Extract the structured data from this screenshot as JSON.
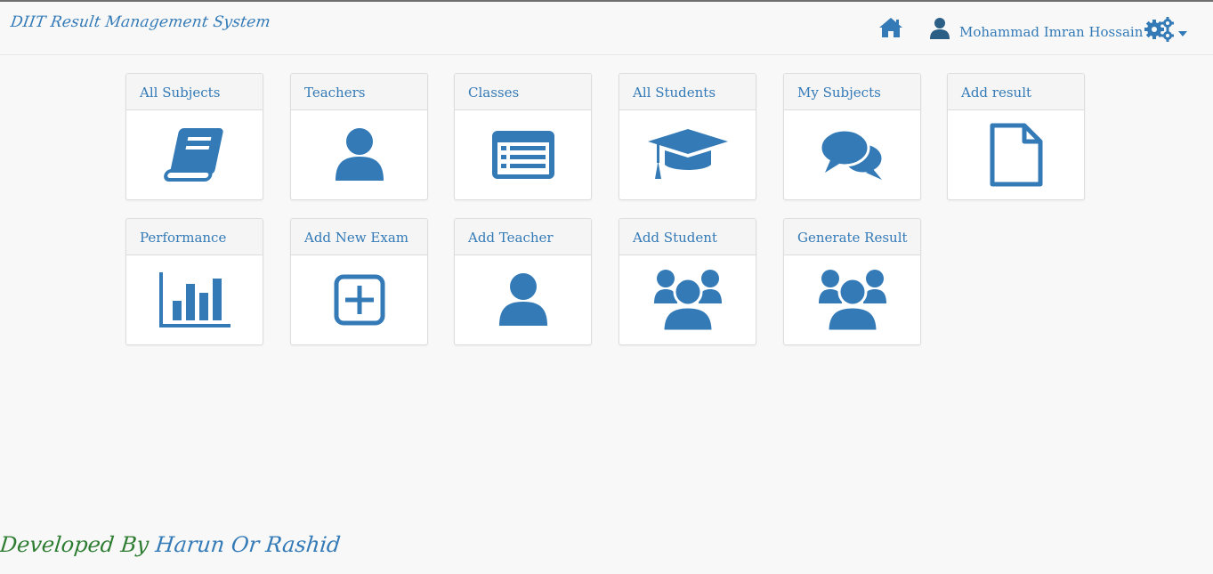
{
  "app": {
    "brand": "DIIT Result Management System"
  },
  "navbar": {
    "home_icon": "home-icon",
    "user_icon": "user-icon",
    "user_name": "Mohammad Imran Hossain",
    "settings_icon": "cogs-icon",
    "settings_caret": "caret-down-icon"
  },
  "colors": {
    "accent": "#337ab7",
    "footer_green": "#2e7d32",
    "panel_head_bg": "#f5f5f5",
    "page_bg": "#f8f8f8"
  },
  "dashboard": {
    "cards": [
      {
        "label": "All Subjects",
        "icon": "book-icon"
      },
      {
        "label": "Teachers",
        "icon": "user-icon"
      },
      {
        "label": "Classes",
        "icon": "list-alt-icon"
      },
      {
        "label": "All Students",
        "icon": "graduation-cap-icon"
      },
      {
        "label": "My Subjects",
        "icon": "comments-icon"
      },
      {
        "label": "Add result",
        "icon": "file-icon"
      },
      {
        "label": "Performance",
        "icon": "bar-chart-icon"
      },
      {
        "label": "Add New Exam",
        "icon": "plus-square-icon"
      },
      {
        "label": "Add Teacher",
        "icon": "user-icon"
      },
      {
        "label": "Add Student",
        "icon": "users-icon"
      },
      {
        "label": "Generate Result",
        "icon": "users-icon"
      }
    ]
  },
  "footer": {
    "developed_by": "Developed By",
    "author": "Harun Or Rashid"
  }
}
